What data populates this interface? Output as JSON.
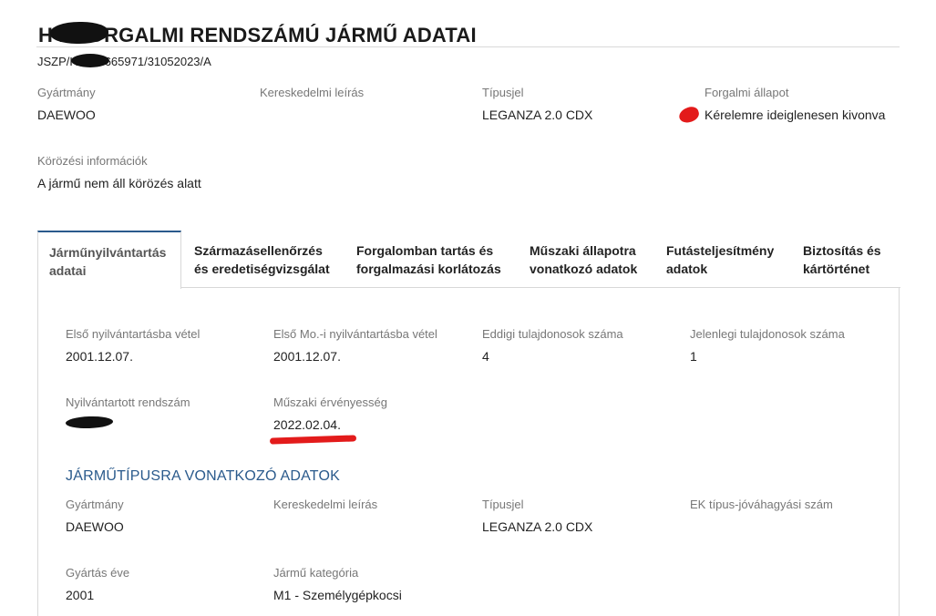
{
  "header": {
    "title": "H      1 FORGALMI RENDSZÁMÚ JÁRMŰ ADATAI",
    "reference": "JSZP/H      1/73665971/31052023/A"
  },
  "summary": {
    "manufacturer_label": "Gyártmány",
    "manufacturer_value": "DAEWOO",
    "commercial_label": "Kereskedelmi leírás",
    "commercial_value": "",
    "type_label": "Típusjel",
    "type_value": "LEGANZA 2.0 CDX",
    "status_label": "Forgalmi állapot",
    "status_value": "Kérelemre ideiglenesen kivonva",
    "status_color": "#e31b1b",
    "wanted_label": "Körözési információk",
    "wanted_value": "A jármű nem áll körözés alatt"
  },
  "tabs": [
    {
      "label": "Járműnyilvántartás adatai",
      "active": true
    },
    {
      "label": "Származásellenőrzés és eredetiségvizsgálat",
      "active": false
    },
    {
      "label": "Forgalomban tartás és forgalmazási korlátozás",
      "active": false
    },
    {
      "label": "Műszaki állapotra vonatkozó adatok",
      "active": false
    },
    {
      "label": "Futásteljesítmény adatok",
      "active": false
    },
    {
      "label": "Biztosítás és kártörténet",
      "active": false
    }
  ],
  "registry": {
    "first_reg_label": "Első nyilvántartásba vétel",
    "first_reg_value": "2001.12.07.",
    "first_reg_hu_label": "Első Mo.-i nyilvántartásba vétel",
    "first_reg_hu_value": "2001.12.07.",
    "prev_owners_label": "Eddigi tulajdonosok száma",
    "prev_owners_value": "4",
    "current_owners_label": "Jelenlegi tulajdonosok száma",
    "current_owners_value": "1",
    "plate_label": "Nyilvántartott rendszám",
    "plate_value": "",
    "inspection_label": "Műszaki érvényesség",
    "inspection_value": "2022.02.04."
  },
  "vehicle_type": {
    "heading": "JÁRMŰTÍPUSRA VONATKOZÓ ADATOK",
    "manufacturer_label": "Gyártmány",
    "manufacturer_value": "DAEWOO",
    "commercial_label": "Kereskedelmi leírás",
    "commercial_value": "",
    "type_label": "Típusjel",
    "type_value": "LEGANZA 2.0 CDX",
    "ek_label": "EK típus-jóváhagyási szám",
    "ek_value": "",
    "year_label": "Gyártás éve",
    "year_value": "2001",
    "category_label": "Jármű kategória",
    "category_value": "M1 - Személygépkocsi"
  },
  "colors": {
    "accent": "#2a5a8c",
    "redaction": "#111111",
    "marker": "#e31b1b"
  }
}
